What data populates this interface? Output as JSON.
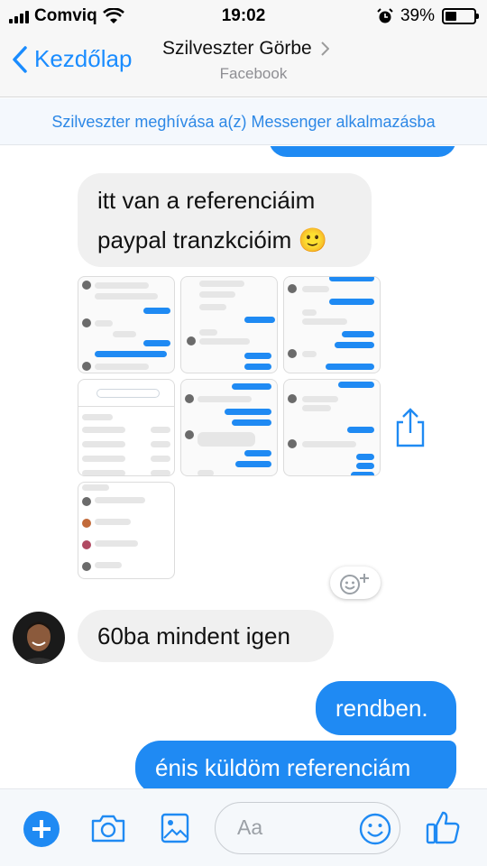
{
  "status": {
    "carrier": "Comviq",
    "time": "19:02",
    "battery": "39%",
    "battery_level": 0.39
  },
  "nav": {
    "back_label": "Kezdőlap",
    "title": "Szilveszter Görbe",
    "subtitle": "Facebook"
  },
  "invite_banner": "Szilveszter meghívása a(z) Messenger alkalmazásba",
  "messages": [
    {
      "side": "in",
      "line1": "itt van a referenciáim",
      "line2": "paypal tranzkcióim 🙂"
    },
    {
      "side": "in",
      "text": "60ba mindent igen"
    },
    {
      "side": "out",
      "text": "rendben."
    },
    {
      "side": "out",
      "text": "énis küldöm referenciám"
    }
  ],
  "composer": {
    "placeholder": "Aa"
  },
  "colors": {
    "accent": "#1f8af3",
    "incoming": "#f0f0f0"
  }
}
